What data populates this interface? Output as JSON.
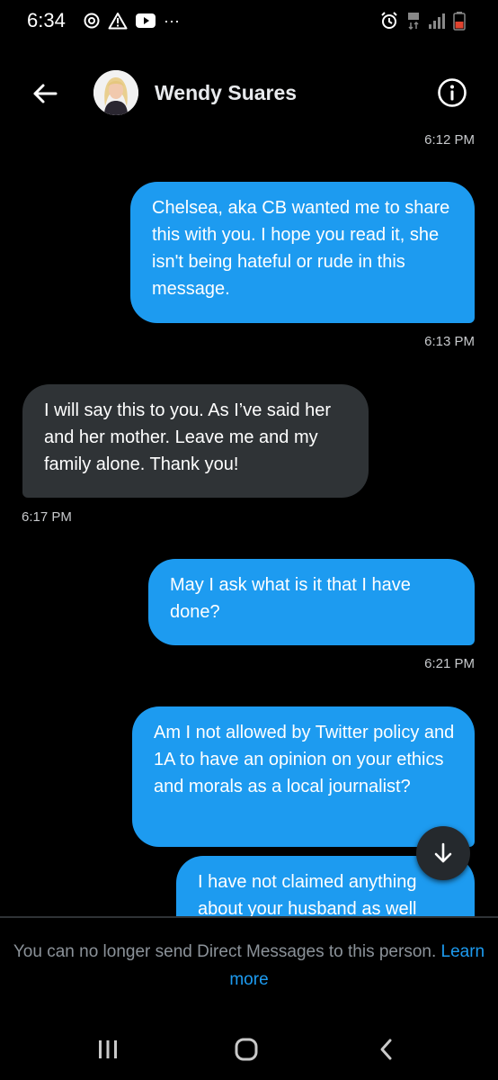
{
  "status_bar": {
    "time": "6:34",
    "left_icons": [
      "sync-icon",
      "warning-icon",
      "youtube-icon"
    ],
    "more": "···",
    "right_icons": [
      "alarm-icon",
      "4g-lte-icon",
      "signal-icon",
      "battery-icon"
    ]
  },
  "header": {
    "name": "Wendy Suares",
    "back_icon": "arrow-left-icon",
    "info_icon": "info-icon"
  },
  "messages": [
    {
      "type": "timestamp",
      "side": "right",
      "text": "6:12 PM"
    },
    {
      "type": "bubble",
      "side": "out",
      "text": "Chelsea, aka CB wanted me to share this with you. I hope you read it, she isn't being hateful or rude in this message."
    },
    {
      "type": "timestamp",
      "side": "right",
      "text": "6:13 PM"
    },
    {
      "type": "bubble",
      "side": "in",
      "text": "I will say this to you. As I’ve said her and her mother. Leave me and my family alone. Thank you!"
    },
    {
      "type": "timestamp",
      "side": "left",
      "text": "6:17 PM"
    },
    {
      "type": "bubble",
      "side": "out",
      "text": "May I ask what is it that I have done?"
    },
    {
      "type": "timestamp",
      "side": "right",
      "text": "6:21 PM"
    },
    {
      "type": "bubble",
      "side": "out",
      "text": "Am I not allowed by Twitter policy and 1A to have an opinion on your ethics and morals as a local journalist?"
    },
    {
      "type": "bubble",
      "side": "out",
      "text": "I have not claimed anything about your husband as well"
    }
  ],
  "scroll_down_icon": "arrow-down-icon",
  "notice": {
    "text": "You can no longer send Direct Messages to this person.",
    "link": "Learn more"
  },
  "nav_bar": {
    "recents_icon": "recents-icon",
    "home_icon": "home-icon",
    "back_icon": "back-chevron-icon"
  },
  "colors": {
    "background": "#000000",
    "outgoing_bubble": "#1d9bf0",
    "incoming_bubble": "#2f3336",
    "link": "#1d9bf0",
    "muted_text": "#8b9299"
  }
}
